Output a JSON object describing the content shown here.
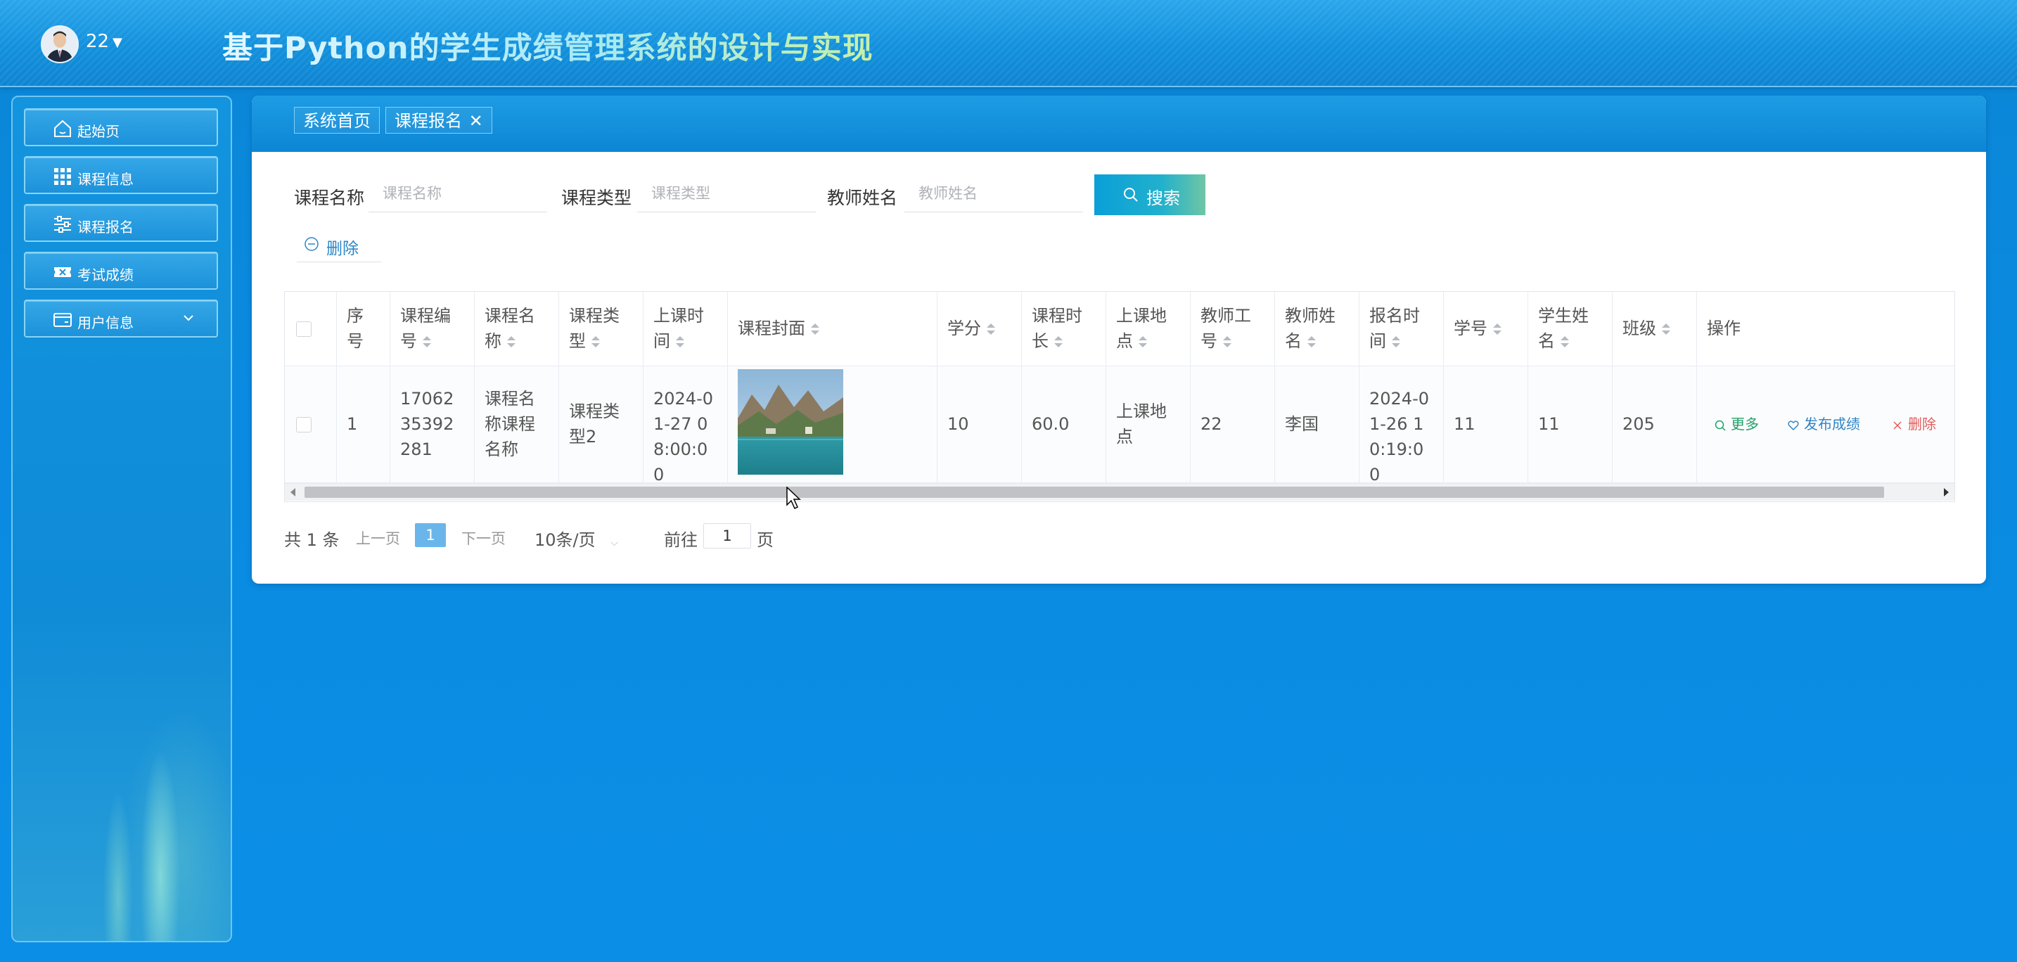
{
  "header": {
    "username": "22",
    "title": "基于Python的学生成绩管理系统的设计与实现"
  },
  "sidebar": {
    "items": [
      {
        "label": "起始页",
        "icon": "home-icon"
      },
      {
        "label": "课程信息",
        "icon": "grid-icon"
      },
      {
        "label": "课程报名",
        "icon": "sliders-icon"
      },
      {
        "label": "考试成绩",
        "icon": "ticket-icon"
      },
      {
        "label": "用户信息",
        "icon": "card-icon",
        "expandable": true
      }
    ]
  },
  "tabs": [
    {
      "label": "系统首页"
    },
    {
      "label": "课程报名",
      "active": true
    }
  ],
  "search": {
    "course_name_label": "课程名称",
    "course_name_placeholder": "课程名称",
    "course_type_label": "课程类型",
    "course_type_placeholder": "课程类型",
    "teacher_name_label": "教师姓名",
    "teacher_name_placeholder": "教师姓名",
    "button_label": "搜索"
  },
  "actions": {
    "delete_label": "删除"
  },
  "table": {
    "headers": {
      "index": "序号",
      "course_no": "课程编号",
      "course_name": "课程名称",
      "course_type": "课程类型",
      "class_time": "上课时间",
      "cover": "课程封面",
      "credit": "学分",
      "duration": "课程时长",
      "location": "上课地点",
      "teacher_id": "教师工号",
      "teacher_name": "教师姓名",
      "signup_time": "报名时间",
      "student_id": "学号",
      "student_name": "学生姓名",
      "class": "班级",
      "ops": "操作"
    },
    "rows": [
      {
        "index": "1",
        "course_no": "1706235392281",
        "course_name": "课程名称课程名称",
        "course_type": "课程类型2",
        "class_time": "2024-01-27 08:00:00",
        "credit": "10",
        "duration": "60.0",
        "location": "上课地点",
        "teacher_id": "22",
        "teacher_name": "李国",
        "signup_time": "2024-01-26 10:19:00",
        "student_id": "11",
        "student_name": "11",
        "class": "205",
        "ops": {
          "more": "更多",
          "publish": "发布成绩",
          "delete": "删除"
        }
      }
    ]
  },
  "pagination": {
    "total_text": "共 1 条",
    "prev": "上一页",
    "current": "1",
    "next": "下一页",
    "page_size": "10条/页",
    "goto_prefix": "前往",
    "goto_value": "1",
    "goto_suffix": "页"
  },
  "colors": {
    "brand": "#0b86d6",
    "accent": "#6ab6ea",
    "more_green": "#22a06b",
    "delete_red": "#e45b5b"
  }
}
